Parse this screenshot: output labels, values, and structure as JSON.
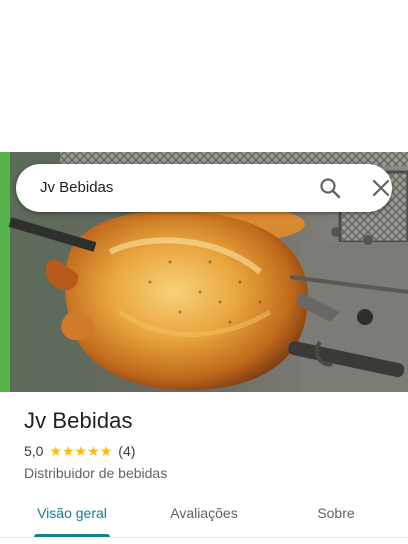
{
  "search": {
    "query": "Jv Bebidas"
  },
  "place": {
    "name": "Jv Bebidas",
    "rating": "5,0",
    "stars": 5,
    "review_count": "(4)",
    "category": "Distribuidor de bebidas"
  },
  "tabs": [
    {
      "label": "Visão geral",
      "active": true
    },
    {
      "label": "Avaliações",
      "active": false
    },
    {
      "label": "Sobre",
      "active": false
    }
  ],
  "colors": {
    "accent": "#137e8f",
    "star": "#fbbc04"
  }
}
